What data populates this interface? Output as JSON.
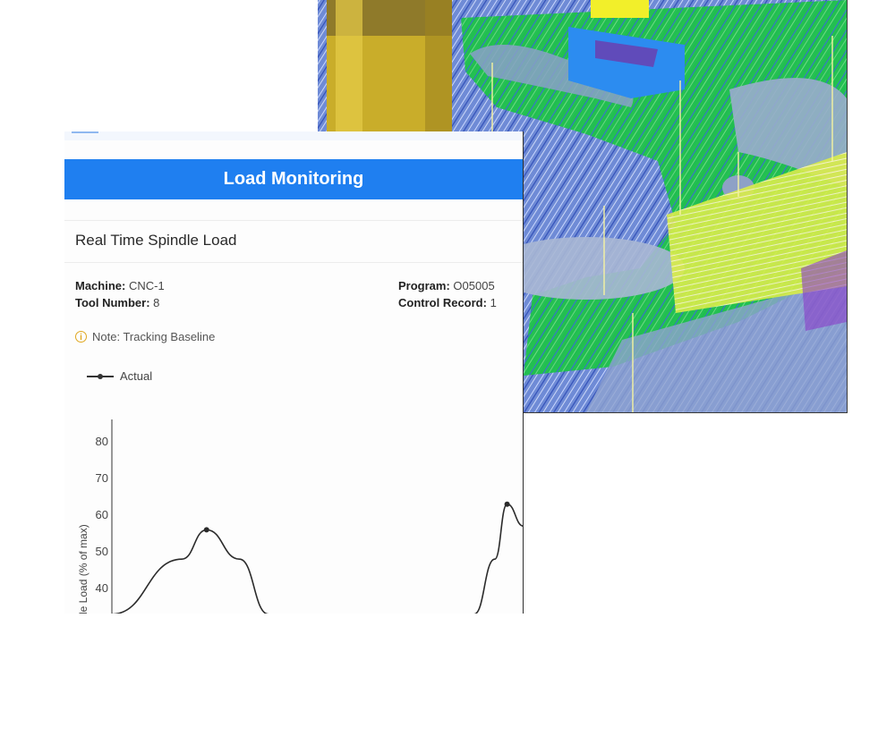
{
  "header": {
    "title": "Load Monitoring"
  },
  "section": {
    "title": "Real Time Spindle Load"
  },
  "info": {
    "machine_label": "Machine:",
    "machine_value": "CNC-1",
    "tool_label": "Tool Number:",
    "tool_value": "8",
    "program_label": "Program:",
    "program_value": "O05005",
    "record_label": "Control Record:",
    "record_value": "1"
  },
  "note": {
    "icon": "info-icon",
    "text": "Note: Tracking Baseline"
  },
  "legend": {
    "label": "Actual"
  },
  "colors": {
    "accent": "#1f7ff0",
    "warning": "#e0a820",
    "series": "#2b2b2b"
  },
  "chart_data": {
    "type": "line",
    "ylabel": "le Load (% of max)",
    "yticks": [
      40,
      50,
      60,
      70,
      80
    ],
    "ylim": [
      32,
      86
    ],
    "series": [
      {
        "name": "Actual",
        "values": [
          [
            0.0,
            33
          ],
          [
            0.17,
            48
          ],
          [
            0.23,
            56
          ],
          [
            0.31,
            48
          ],
          [
            0.38,
            33
          ],
          [
            0.88,
            33
          ],
          [
            0.93,
            48
          ],
          [
            0.96,
            63
          ],
          [
            1.0,
            57
          ],
          [
            1.03,
            50
          ]
        ],
        "markers": [
          [
            0.23,
            56
          ],
          [
            0.96,
            63
          ]
        ]
      }
    ]
  }
}
